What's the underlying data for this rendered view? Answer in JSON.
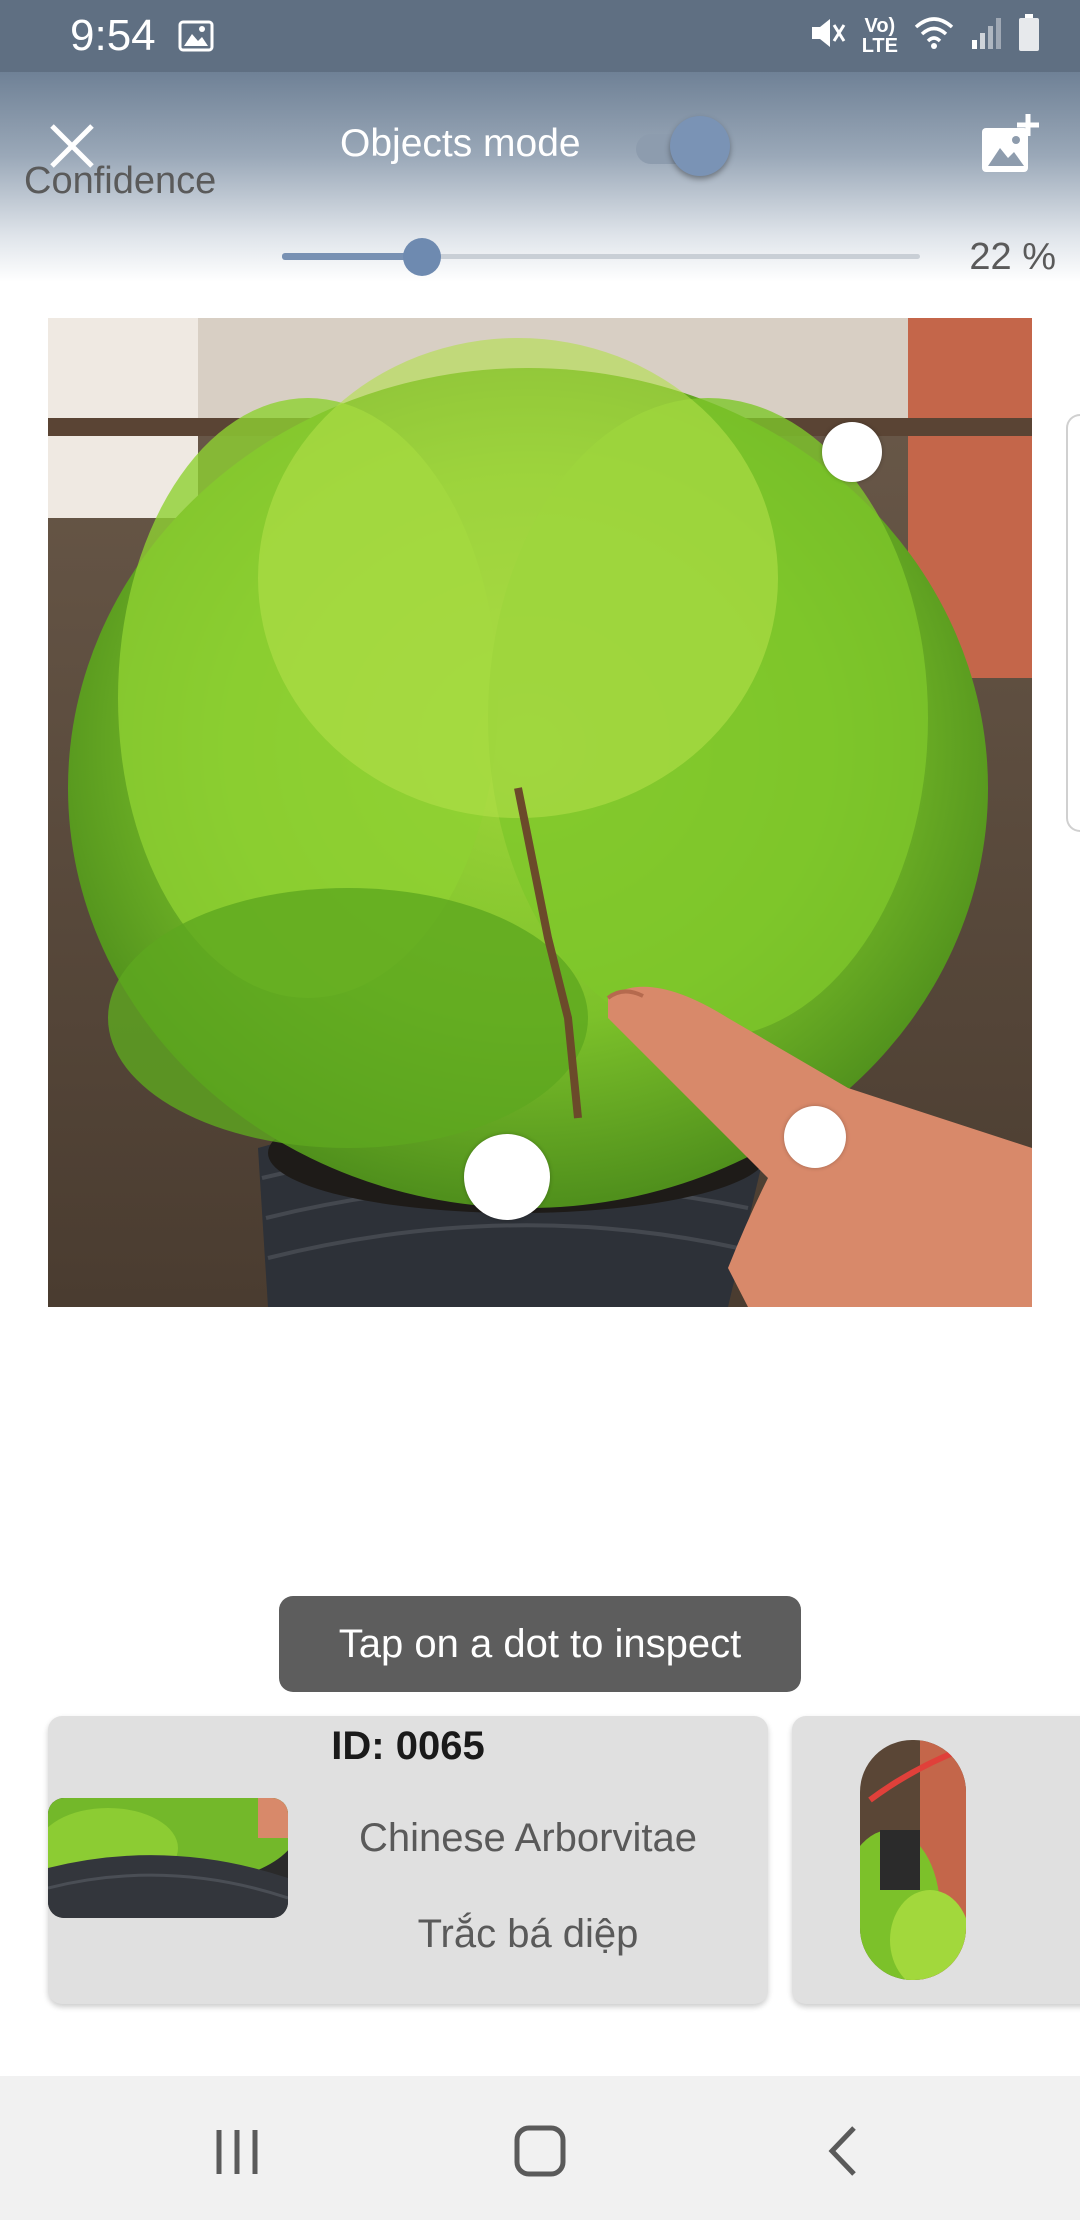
{
  "status_bar": {
    "time": "9:54",
    "network_label_top": "Vo)",
    "network_label_bottom": "LTE",
    "icons": [
      "gallery-icon",
      "mute-icon",
      "volte-icon",
      "wifi-icon",
      "signal-icon",
      "battery-icon"
    ]
  },
  "header": {
    "close_icon": "close-icon",
    "mode_label": "Objects mode",
    "mode_toggle_on": true,
    "add_image_icon": "add-photo-icon"
  },
  "confidence": {
    "label": "Confidence",
    "value_text": "22 %",
    "value_fraction": 0.22
  },
  "photo": {
    "detection_dots": 3
  },
  "toast": {
    "text": "Tap on a dot to inspect"
  },
  "cards": [
    {
      "id_label": "ID: 0065",
      "name_en": "Chinese Arborvitae",
      "name_vi": "Trắc bá diệp"
    }
  ],
  "nav": {
    "icons": [
      "recents-icon",
      "home-icon",
      "back-icon"
    ]
  },
  "colors": {
    "status_bar": "#5f6f82",
    "accent": "#7891b3",
    "toast_bg": "#5d5d5d",
    "card_bg": "#e0e0e0",
    "nav_bg": "#f1f1f1"
  }
}
